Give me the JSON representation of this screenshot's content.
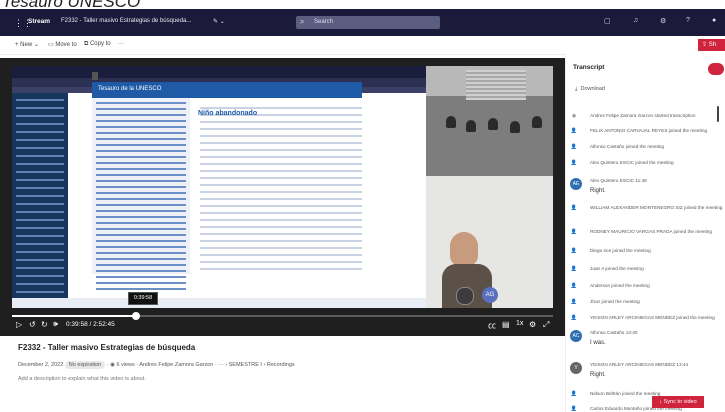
{
  "header": {
    "page_title": "Tesauro UNESCO"
  },
  "topbar": {
    "app_name": "Stream",
    "breadcrumb": "F2332 - Taller masivo Estrategias de búsqueda...",
    "search_placeholder": "Search"
  },
  "cmdbar": {
    "new_label": "New",
    "move_label": "Move to",
    "copy_label": "Copy to",
    "share_label": "Sh"
  },
  "video": {
    "inner_search_title": "Tesauro de la UNESCO",
    "inner_term": "Niño abandonado",
    "tooltip_time": "0:39:58",
    "time_display": "0:39:58 / 2:52:45",
    "progress_fraction": 0.23,
    "speed_label": "1x",
    "avatar_label": "AG"
  },
  "info": {
    "title": "F2332 - Taller masivo Estrategias de búsqueda",
    "date": "December 2, 2022",
    "expiration": "No expiration",
    "views": "6 views",
    "author": "Andres Felipe Zamora Garzon",
    "path1": "SEMESTRE I",
    "path2": "Recordings",
    "description_placeholder": "Add a description to explain what this video is about."
  },
  "transcript": {
    "title": "Transcript",
    "download_label": "Download",
    "sync_label": "Sync to video",
    "entries": [
      {
        "kind": "event",
        "text": "Andres Felipe Zamora Garzon started transcription"
      },
      {
        "kind": "event",
        "text": "FELIX ANTONIO CARVAJAL REYES joined the meeting"
      },
      {
        "kind": "event",
        "text": "Alfonso Castaño joined the meeting"
      },
      {
        "kind": "event",
        "text": "Alex Quintero ESCIC joined the meeting"
      },
      {
        "kind": "speaker",
        "initials": "AE",
        "color": "#2f6fb0",
        "name": "Alex Quintero ESCIC   11:48",
        "text": "Right."
      },
      {
        "kind": "event",
        "text": "WILLIAM ALEXANDER MONTENEGRO SIZ joined the meeting"
      },
      {
        "kind": "event",
        "text": "RODNEY MAURICIO VARGAS PRADA joined the meeting"
      },
      {
        "kind": "event",
        "text": "Diego rice joined the meeting"
      },
      {
        "kind": "event",
        "text": "Juan A joined the meeting"
      },
      {
        "kind": "event",
        "text": "Anderson joined the meeting"
      },
      {
        "kind": "event",
        "text": "Jhon joined the meeting"
      },
      {
        "kind": "event",
        "text": "YEISON ARLEY ARCINIEGAS MENDEZ joined the meeting"
      },
      {
        "kind": "speaker",
        "initials": "AC",
        "color": "#2f6fb0",
        "name": "Alfonso Castaño   13:40",
        "text": "I was."
      },
      {
        "kind": "speaker",
        "initials": "Y",
        "color": "#666666",
        "name": "YEISON ARLEY ARCINIEGAS MENDEZ   13:44",
        "text": "Right."
      },
      {
        "kind": "event",
        "text": "Nelson Beltrán joined the meeting"
      },
      {
        "kind": "event",
        "text": "Carlos Eduardo Montaño joined the meeting"
      }
    ]
  },
  "colors": {
    "accent": "#d0233c",
    "topbar": "#1b1a3a",
    "player": "#1f1f1f"
  }
}
